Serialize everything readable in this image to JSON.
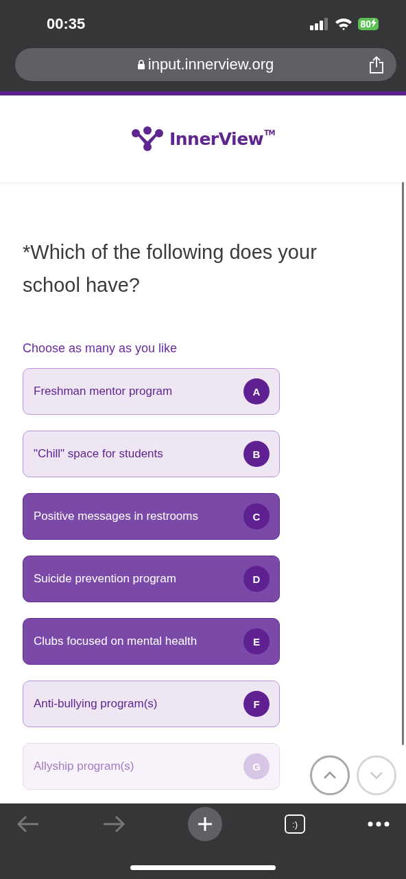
{
  "status_bar": {
    "time": "00:35",
    "battery": "80"
  },
  "browser": {
    "url": "input.innerview.org"
  },
  "header": {
    "logo_text": "InnerView",
    "trademark": "TM"
  },
  "question": {
    "title": "*Which of the following does your school have?",
    "hint": "Choose as many as you like"
  },
  "options": [
    {
      "label": "Freshman mentor program",
      "letter": "A",
      "selected": false,
      "dimmed": false
    },
    {
      "label": "\"Chill\" space for students",
      "letter": "B",
      "selected": false,
      "dimmed": false
    },
    {
      "label": "Positive messages in restrooms",
      "letter": "C",
      "selected": true,
      "dimmed": false
    },
    {
      "label": "Suicide prevention program",
      "letter": "D",
      "selected": true,
      "dimmed": false
    },
    {
      "label": "Clubs focused on mental health",
      "letter": "E",
      "selected": true,
      "dimmed": false
    },
    {
      "label": "Anti-bullying program(s)",
      "letter": "F",
      "selected": false,
      "dimmed": false
    },
    {
      "label": "Allyship program(s)",
      "letter": "G",
      "selected": false,
      "dimmed": true
    }
  ],
  "nav": [
    {
      "kind": "up",
      "disabled": false
    },
    {
      "kind": "down",
      "disabled": true
    }
  ],
  "toolbar": {
    "tabs_label": ":)"
  }
}
